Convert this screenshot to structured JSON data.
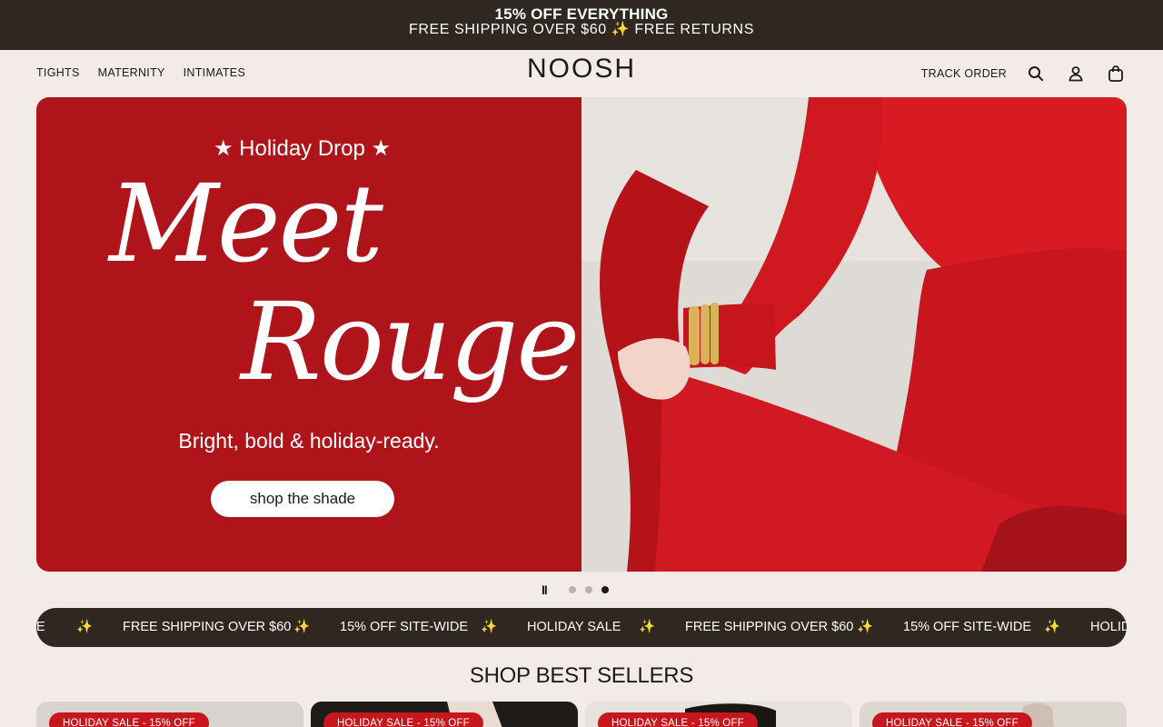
{
  "announcement": {
    "line1": "15% OFF EVERYTHING",
    "line2": "FREE SHIPPING OVER $60 ✨ FREE RETURNS"
  },
  "nav": {
    "links": [
      "TIGHTS",
      "MATERNITY",
      "INTIMATES"
    ],
    "logo": "NOOSH",
    "track_order": "TRACK ORDER",
    "icons": [
      "search-icon",
      "account-icon",
      "cart-icon"
    ]
  },
  "hero": {
    "eyebrow": "★ Holiday Drop ★",
    "script_line1": "Meet",
    "script_line2": "Rouge",
    "subtitle": "Bright, bold & holiday-ready.",
    "cta": "shop the shade",
    "bg_color": "#b0141b"
  },
  "carousel": {
    "pause_label": "II",
    "active_index": 3,
    "count": 3
  },
  "marquee": {
    "items": [
      "E",
      "✨",
      "FREE SHIPPING OVER $60",
      "✨",
      "15% OFF SITE-WIDE",
      "✨",
      "HOLIDAY SALE",
      "✨",
      "FREE SHIPPING OVER $60",
      "✨",
      "15% OFF SITE-WIDE",
      "✨",
      "HOLID"
    ]
  },
  "best_sellers": {
    "title": "SHOP BEST SELLERS",
    "badges": [
      "HOLIDAY SALE - 15% OFF",
      "HOLIDAY SALE - 15% OFF",
      "HOLIDAY SALE - 15% OFF",
      "HOLIDAY SALE - 15% OFF"
    ]
  }
}
